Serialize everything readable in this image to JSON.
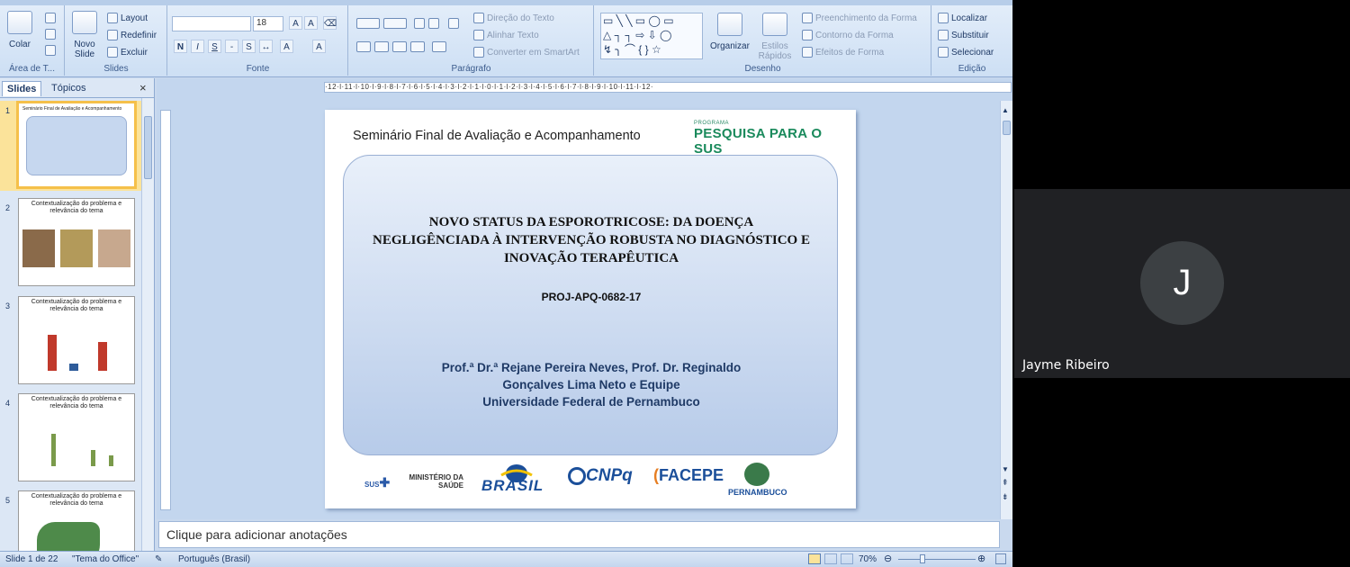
{
  "ribbon": {
    "clipboard": {
      "paste_label": "Colar",
      "group_label": "Área de T..."
    },
    "slides": {
      "new_slide_label": "Novo Slide",
      "layout_label": "Layout",
      "reset_label": "Redefinir",
      "delete_label": "Excluir",
      "group_label": "Slides"
    },
    "font": {
      "font_size": "18",
      "group_label": "Fonte"
    },
    "paragraph": {
      "text_direction_label": "Direção do Texto",
      "align_text_label": "Alinhar Texto",
      "smartart_label": "Converter em SmartArt",
      "group_label": "Parágrafo"
    },
    "drawing": {
      "arrange_label": "Organizar",
      "quick_styles_label": "Estilos Rápidos",
      "shape_fill_label": "Preenchimento da Forma",
      "shape_outline_label": "Contorno da Forma",
      "shape_effects_label": "Efeitos de Forma",
      "group_label": "Desenho"
    },
    "editing": {
      "find_label": "Localizar",
      "replace_label": "Substituir",
      "select_label": "Selecionar",
      "group_label": "Edição"
    }
  },
  "left_panel": {
    "tabs": [
      "Slides",
      "Tópicos"
    ],
    "close_glyph": "×",
    "thumbnails": [
      {
        "number": "1",
        "title": "Seminário Final de Avaliação e Acompanhamento"
      },
      {
        "number": "2",
        "title": "Contextualização do problema e relevância do tema"
      },
      {
        "number": "3",
        "title": "Contextualização do problema e relevância do tema"
      },
      {
        "number": "4",
        "title": "Contextualização do problema e relevância do tema"
      },
      {
        "number": "5",
        "title": "Contextualização do problema e relevância do tema"
      }
    ]
  },
  "ruler": {
    "text": "·12·l·11·l·10·l·9·l·8·l·7·l·6·l·5·l·4·l·3·l·2·l·1·l·0·l·1·l·2·l·3·l·4·l·5·l·6·l·7·l·8·l·9·l·10·l·11·l·12·"
  },
  "slide": {
    "header": "Seminário Final de Avaliação e Acompanhamento",
    "program_logo_small": "PROGRAMA",
    "program_logo": "PESQUISA PARA O SUS",
    "title": "NOVO STATUS DA ESPOROTRICOSE: DA DOENÇA NEGLIGÊNCIADA À INTERVENÇÃO ROBUSTA NO DIAGNÓSTICO E INOVAÇÃO TERAPÊUTICA",
    "project_code": "PROJ-APQ-0682-17",
    "authors_line1": "Prof.ª Dr.ª Rejane Pereira Neves, Prof. Dr. Reginaldo",
    "authors_line2": "Gonçalves Lima Neto  e Equipe",
    "university": "Universidade Federal de Pernambuco",
    "logos": {
      "sus": "SUS",
      "ministerio": "MINISTÉRIO DA SAÚDE",
      "brasil": "BRASIL",
      "cnpq": "CNPq",
      "facepe": "FACEPE",
      "pernambuco": "PERNAMBUCO"
    }
  },
  "notes_placeholder": "Clique para adicionar anotações",
  "status_bar": {
    "slide_info": "Slide 1 de 22",
    "theme": "\"Tema do Office\"",
    "language": "Português (Brasil)",
    "zoom": "70%"
  },
  "video": {
    "avatar_letter": "J",
    "participant_name": "Jayme Ribeiro"
  },
  "colors": {
    "ribbon": "#cddff4",
    "accent": "#1f3a66",
    "video_tile": "#202124",
    "avatar": "#3c4043",
    "program_logo": "#1a8a5c"
  }
}
